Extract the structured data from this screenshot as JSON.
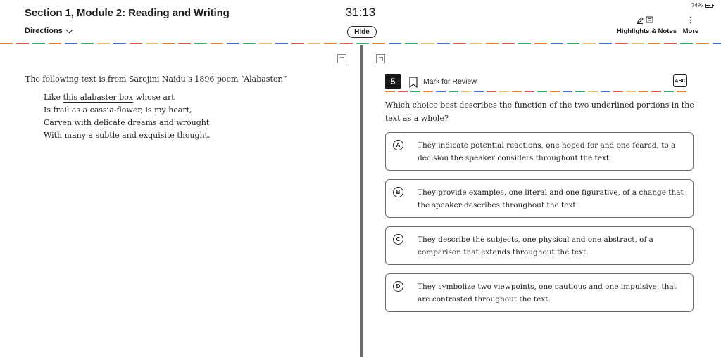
{
  "header": {
    "section_title": "Section 1, Module 2: Reading and Writing",
    "directions_label": "Directions",
    "timer": "31:13",
    "hide_label": "Hide",
    "battery": "74%",
    "highlights_notes_label": "Highlights & Notes",
    "more_label": "More"
  },
  "passage": {
    "intro": "The following text is from Sarojini Naidu’s 1896 poem “Alabaster.”",
    "lines": [
      {
        "pre": "Like ",
        "ul": "this alabaster box",
        "post": " whose art"
      },
      {
        "pre": "Is frail as a cassia-flower, is ",
        "ul": "my heart",
        "post": ","
      },
      {
        "pre": "Carven with delicate dreams and wrought",
        "ul": "",
        "post": ""
      },
      {
        "pre": "With many a subtle and exquisite thought.",
        "ul": "",
        "post": ""
      }
    ]
  },
  "question": {
    "number": "5",
    "mark_for_review_label": "Mark for Review",
    "abc_label": "ABC",
    "text": "Which choice best describes the function of the two underlined portions in the text as a whole?",
    "choices": [
      {
        "letter": "A",
        "text": "They indicate potential reactions, one hoped for and one feared, to a decision the speaker considers throughout the text."
      },
      {
        "letter": "B",
        "text": "They provide examples, one literal and one figurative, of a change that the speaker describes throughout the text."
      },
      {
        "letter": "C",
        "text": "They describe the subjects, one physical and one abstract, of a comparison that extends throughout the text."
      },
      {
        "letter": "D",
        "text": "They symbolize two viewpoints, one cautious and one impulsive, that are contrasted throughout the text."
      }
    ]
  },
  "colors": {
    "dash_palette": [
      "#e0843a",
      "#3fa86a",
      "#4e6fc4",
      "#e0c070",
      "#d65a5a"
    ],
    "divider": "#6b6b6b"
  }
}
